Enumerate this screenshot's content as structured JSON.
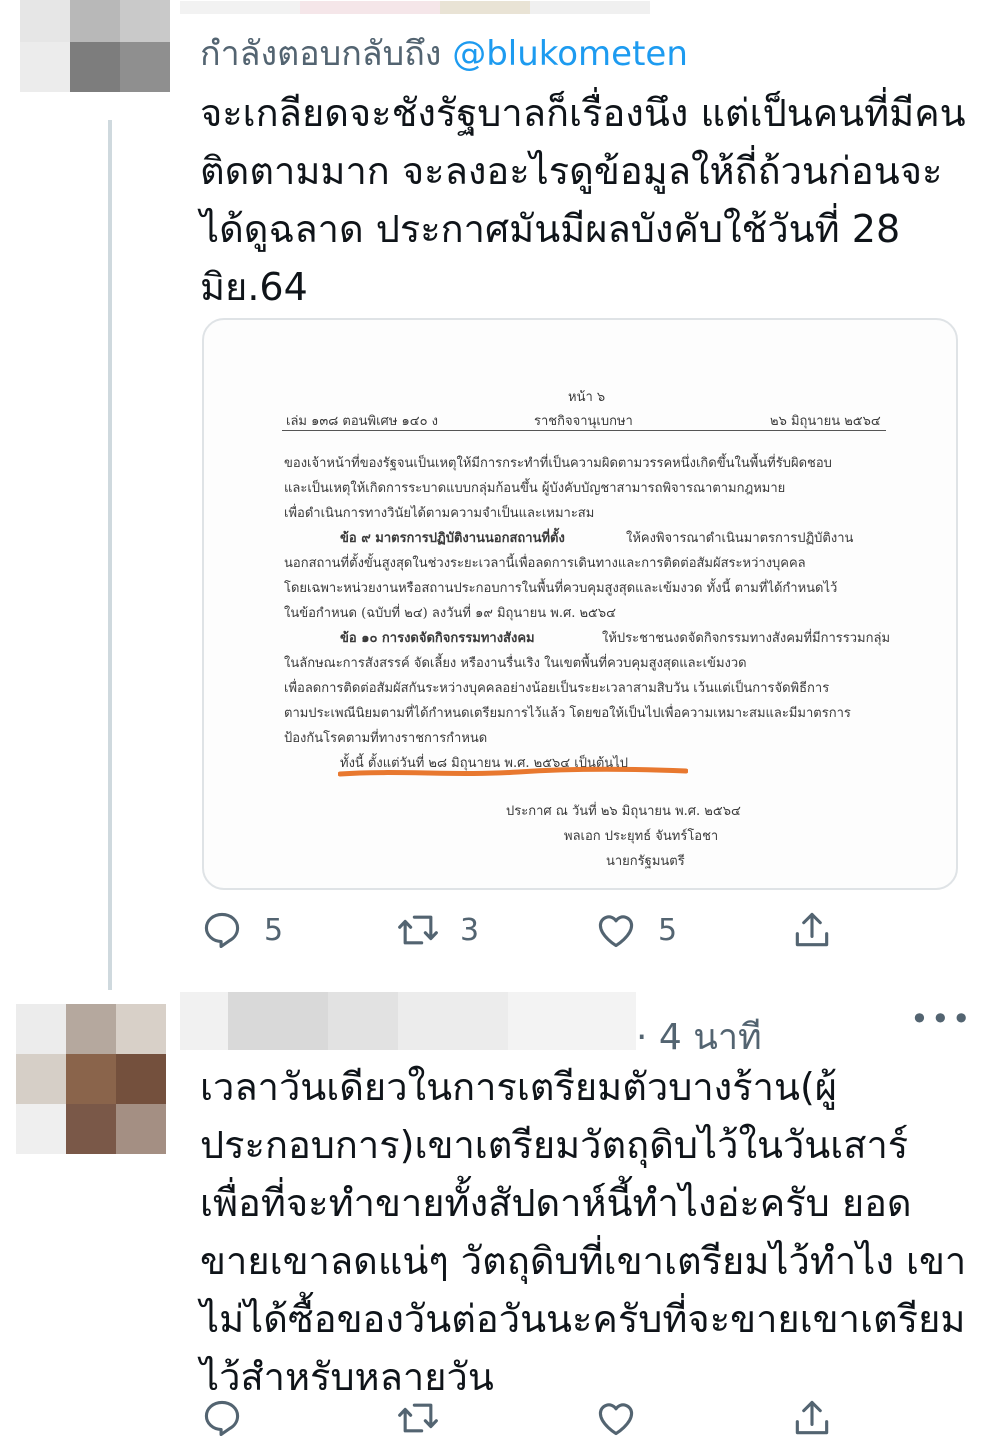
{
  "tweet1": {
    "reply_prefix": "กำลังตอบกลับถึง ",
    "reply_handle": "@blukometen",
    "text": "จะเกลียดจะชังรัฐบาลก็เรื่องนึง แต่เป็นคนที่มีคนติดตามมาก จะลงอะไรดูข้อมูลให้ถี่ถ้วนก่อนจะได้ดูฉลาด ประกาศมันมีผลบังคับใช้วันที่ 28 มิย.64",
    "document": {
      "page_no": "หน้า ๖",
      "header_left": "เล่ม ๑๓๘ ตอนพิเศษ ๑๔๐ ง",
      "header_center": "ราชกิจจานุเบกษา",
      "header_right": "๒๖ มิถุนายน ๒๕๖๔",
      "lines": [
        "ของเจ้าหน้าที่ของรัฐจนเป็นเหตุให้มีการกระทำที่เป็นความผิดตามวรรคหนึ่งเกิดขึ้นในพื้นที่รับผิดชอบ",
        "และเป็นเหตุให้เกิดการระบาดแบบกลุ่มก้อนขึ้น ผู้บังคับบัญชาสามารถพิจารณาตามกฎหมาย",
        "เพื่อดำเนินการทางวินัยได้ตามความจำเป็นและเหมาะสม"
      ],
      "clause9_title": "ข้อ ๙ มาตรการปฏิบัติงานนอกสถานที่ตั้ง",
      "clause9_first": "ให้คงพิจารณาดำเนินมาตรการปฏิบัติงาน",
      "clause9_lines": [
        "นอกสถานที่ตั้งขั้นสูงสุดในช่วงระยะเวลานี้เพื่อลดการเดินทางและการติดต่อสัมผัสระหว่างบุคคล",
        "โดยเฉพาะหน่วยงานหรือสถานประกอบการในพื้นที่ควบคุมสูงสุดและเข้มงวด ทั้งนี้ ตามที่ได้กำหนดไว้",
        "ในข้อกำหนด (ฉบับที่ ๒๔) ลงวันที่ ๑๙ มิถุนายน พ.ศ. ๒๕๖๔"
      ],
      "clause10_title": "ข้อ ๑๐ การงดจัดกิจกรรมทางสังคม",
      "clause10_first": "ให้ประชาชนงดจัดกิจกรรมทางสังคมที่มีการรวมกลุ่ม",
      "clause10_lines": [
        "ในลักษณะการสังสรรค์ จัดเลี้ยง หรืองานรื่นเริง ในเขตพื้นที่ควบคุมสูงสุดและเข้มงวด",
        "เพื่อลดการติดต่อสัมผัสกันระหว่างบุคคลอย่างน้อยเป็นระยะเวลาสามสิบวัน เว้นแต่เป็นการจัดพิธีการ",
        "ตามประเพณีนิยมตามที่ได้กำหนดเตรียมการไว้แล้ว โดยขอให้เป็นไปเพื่อความเหมาะสมและมีมาตรการ",
        "ป้องกันโรคตามที่ทางราชการกำหนด"
      ],
      "effective": "ทั้งนี้ ตั้งแต่วันที่ ๒๘ มิถุนายน พ.ศ. ๒๕๖๔ เป็นต้นไป",
      "announced": "ประกาศ ณ วันที่ ๒๖ มิถุนายน พ.ศ. ๒๕๖๔",
      "signer": "พลเอก ประยุทธ์ จันทร์โอชา",
      "signer_title": "นายกรัฐมนตรี",
      "underline_color": "#e8782f"
    },
    "stats": {
      "replies": "5",
      "retweets": "3",
      "likes": "5"
    }
  },
  "tweet2": {
    "time": "· 4 นาที",
    "more": "•••",
    "text": "เวลาวันเดียวในการเตรียมตัวบางร้าน(ผู้ประกอบการ)เขาเตรียมวัตถุดิบไว้ในวันเสาร์ เพื่อที่จะทำขายทั้งสัปดาห์นี้ทำไงอ่ะครับ ยอดขายเขาลดแน่ๆ วัตถุดิบที่เขาเตรียมไว้ทำไง เขาไม่ได้ซื้อของวันต่อวันนะครับที่จะขายเขาเตรียมไว้สำหรับหลายวัน"
  },
  "colors": {
    "link": "#1d9bf0",
    "muted": "#536471",
    "text": "#0f1419"
  }
}
